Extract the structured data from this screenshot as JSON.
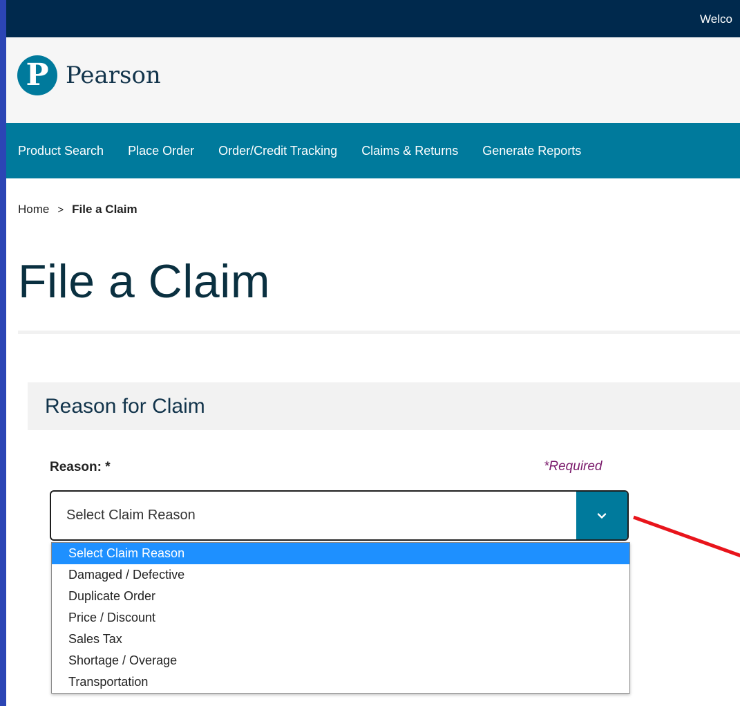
{
  "header": {
    "welcome_text": "Welco"
  },
  "brand": {
    "logo_mark": "P",
    "logo_name": "Pearson"
  },
  "nav": {
    "items": [
      {
        "label": "Product Search"
      },
      {
        "label": "Place Order"
      },
      {
        "label": "Order/Credit Tracking"
      },
      {
        "label": "Claims & Returns"
      },
      {
        "label": "Generate Reports"
      }
    ]
  },
  "breadcrumb": {
    "home": "Home",
    "separator": ">",
    "current": "File a Claim"
  },
  "page": {
    "title": "File a Claim"
  },
  "section": {
    "title": "Reason for Claim"
  },
  "reason_field": {
    "label": "Reason: *",
    "required_note": "*Required",
    "selected_value": "Select Claim Reason",
    "options": [
      "Select Claim Reason",
      "Damaged / Defective",
      "Duplicate Order",
      "Price / Discount",
      "Sales Tax",
      "Shortage / Overage",
      "Transportation"
    ]
  },
  "colors": {
    "top_bar": "#00294d",
    "brand_teal": "#007a9c",
    "selected_option": "#1e90ff",
    "annotation_arrow": "#e8141b",
    "frame": "#2b45b5"
  },
  "icons": {
    "select_toggle": "chevron-down-icon"
  }
}
